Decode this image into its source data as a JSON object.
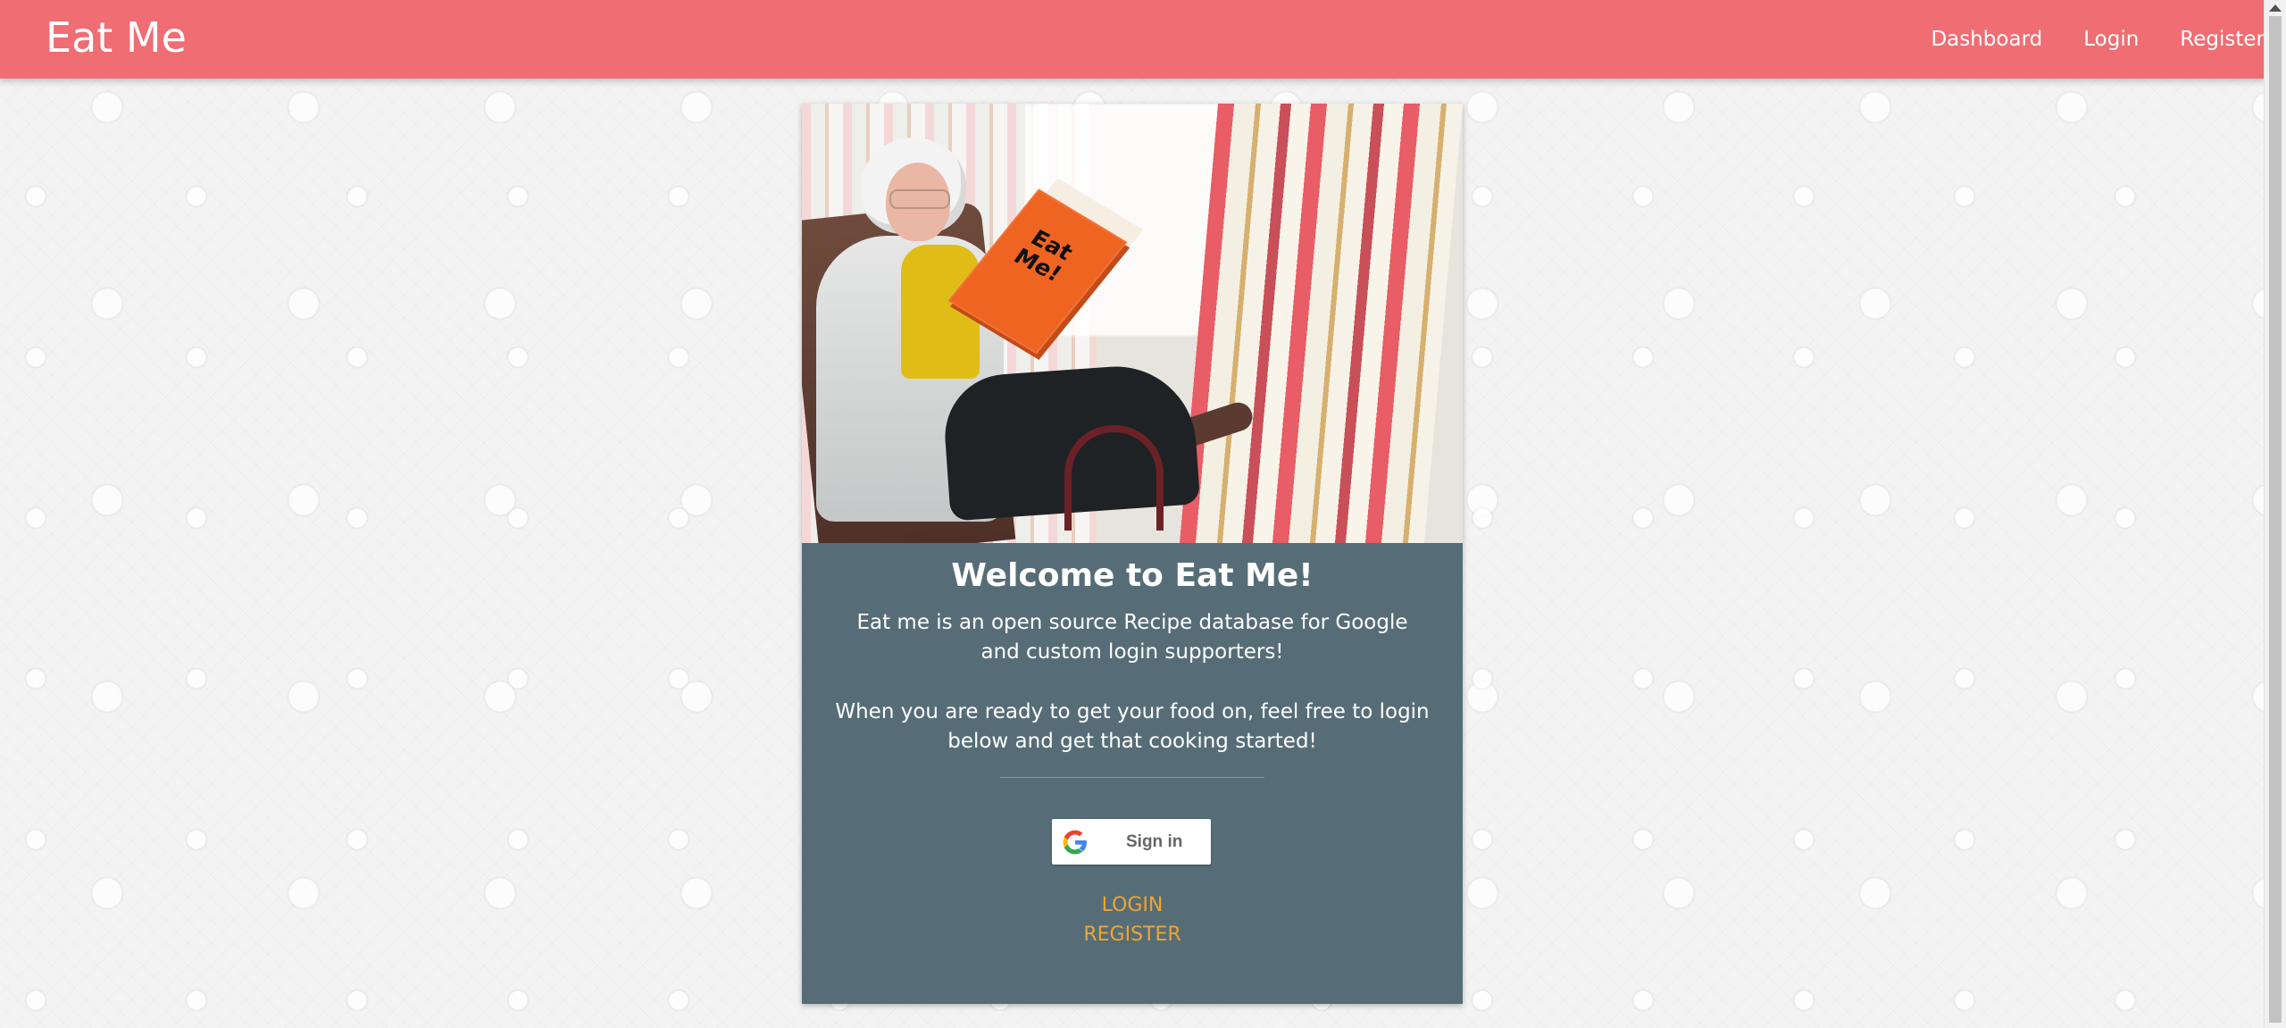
{
  "nav": {
    "brand": "Eat Me",
    "items": [
      {
        "label": "Dashboard"
      },
      {
        "label": "Login"
      },
      {
        "label": "Register"
      }
    ]
  },
  "hero": {
    "book_title": "Eat\nMe!"
  },
  "card": {
    "title": "Welcome to Eat Me!",
    "description": "Eat me is an open source Recipe database for Google and custom login supporters!",
    "message": "When you are ready to get your food on, feel free to login below and get that cooking started!",
    "google_button": "Sign in",
    "login_link": "LOGIN",
    "register_link": "REGISTER"
  },
  "colors": {
    "accent": "#ef6d73",
    "card": "#566d77",
    "link": "#f1a42f"
  }
}
